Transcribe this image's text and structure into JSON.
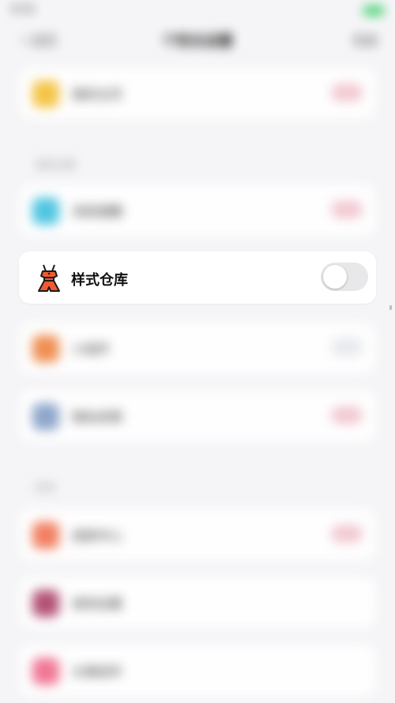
{
  "status_bar": {
    "time": "9:41",
    "carrier": "",
    "battery_color": "#29c95a"
  },
  "nav": {
    "back_label": "〈 返回",
    "title": "个性化设置",
    "action_label": "完成"
  },
  "background": {
    "sections": [
      {
        "label": "通用设置"
      },
      {
        "label": "其他"
      }
    ],
    "rows": [
      {
        "label": "我的主页",
        "icon_color": "#f6c23e"
      },
      {
        "label": "消息提醒",
        "icon_color": "#48c3e0"
      },
      {
        "label": "小组件",
        "icon_color": "#f08a4b"
      },
      {
        "label": "隐私权限",
        "icon_color": "#8aa3c9"
      },
      {
        "label": "皮肤中心",
        "icon_color": "#f27a5a"
      },
      {
        "label": "音效设置",
        "icon_color": "#b04a6f"
      },
      {
        "label": "头像挂件",
        "icon_color": "#f17090"
      }
    ]
  },
  "setting_card": {
    "label": "样式仓库",
    "icon": "dress-icon",
    "toggle_on": false,
    "accent_color": "#f05a32"
  }
}
